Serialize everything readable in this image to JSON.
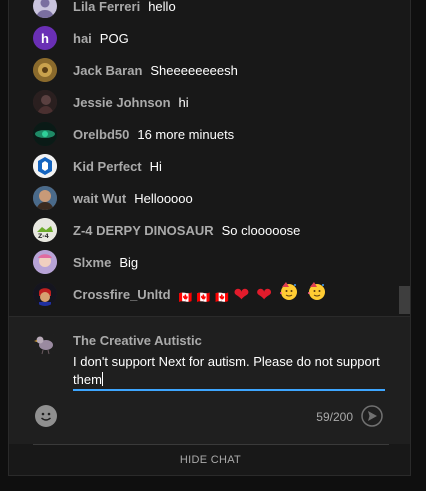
{
  "chat": {
    "messages": [
      {
        "author": "Lila Ferreri",
        "text": "hello",
        "avatar_icon": "avatar-silhouette-icon",
        "avatar_color": "#c9c4dd"
      },
      {
        "author": "hai",
        "text": "POG",
        "avatar_letter": "h",
        "avatar_color": "#6a2fb5"
      },
      {
        "author": "Jack Baran",
        "text": "Sheeeeeeeesh",
        "avatar_icon": "avatar-photo-icon",
        "avatar_color": "#8a6a2c"
      },
      {
        "author": "Jessie Johnson",
        "text": "hi",
        "avatar_icon": "avatar-photo-icon",
        "avatar_color": "#3a2a2a"
      },
      {
        "author": "Orelbd50",
        "text": "16 more minuets",
        "avatar_icon": "avatar-photo-icon",
        "avatar_color": "#1e8a66"
      },
      {
        "author": "Kid Perfect",
        "text": "Hi",
        "avatar_icon": "avatar-logo-icon",
        "avatar_color": "#f2f2f2"
      },
      {
        "author": "wait Wut",
        "text": "Hellooooo",
        "avatar_icon": "avatar-photo-icon",
        "avatar_color": "#6b5040"
      },
      {
        "author": "Z-4 DERPY DINOSAUR",
        "text": "So clooooose",
        "avatar_icon": "avatar-photo-icon",
        "avatar_color": "#e8e8e0"
      },
      {
        "author": "Slxme",
        "text": "Big",
        "avatar_icon": "avatar-photo-icon",
        "avatar_color": "#b7a3d6"
      },
      {
        "author": "Crossfire_Unltd",
        "text": "",
        "avatar_icon": "avatar-photo-icon",
        "avatar_color": "#2a2a3a",
        "emojis": [
          "canada-flag-emoji",
          "canada-flag-emoji",
          "canada-flag-emoji",
          "red-heart-emoji",
          "red-heart-emoji",
          "partying-face-emoji",
          "partying-face-emoji"
        ]
      }
    ]
  },
  "input": {
    "author": "The Creative Autistic",
    "value": "I don't support Next for autism. Please do not support them",
    "char_count": "59/200",
    "emoji_icon": "smiley-face-icon",
    "send_icon": "send-arrow-icon",
    "accent_color": "#3ea6ff"
  },
  "footer": {
    "hide_chat_label": "HIDE CHAT"
  }
}
